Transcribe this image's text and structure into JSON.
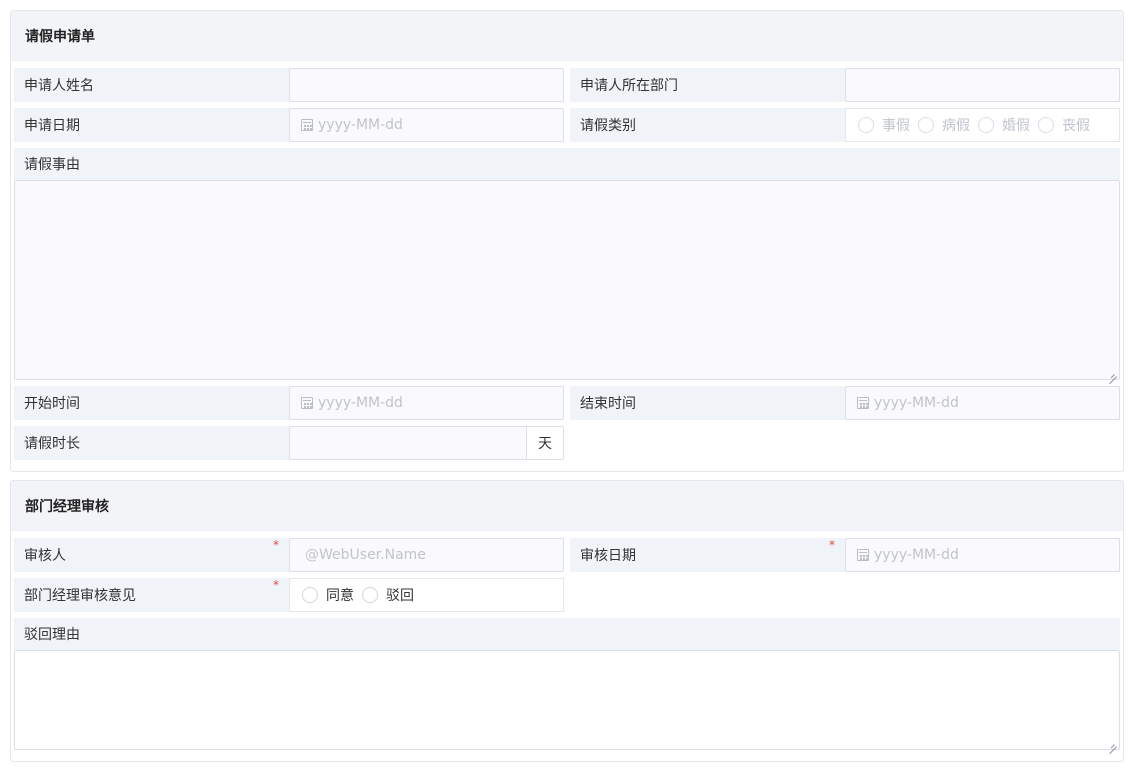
{
  "leave_form": {
    "title": "请假申请单",
    "applicant_name_label": "申请人姓名",
    "applicant_dept_label": "申请人所在部门",
    "apply_date_label": "申请日期",
    "apply_date_placeholder": "yyyy-MM-dd",
    "leave_type_label": "请假类别",
    "leave_type_options": [
      "事假",
      "病假",
      "婚假",
      "丧假"
    ],
    "reason_label": "请假事由",
    "start_time_label": "开始时间",
    "start_time_placeholder": "yyyy-MM-dd",
    "end_time_label": "结束时间",
    "end_time_placeholder": "yyyy-MM-dd",
    "duration_label": "请假时长",
    "duration_unit": "天"
  },
  "manager_review": {
    "title": "部门经理审核",
    "reviewer_label": "审核人",
    "reviewer_placeholder": "@WebUser.Name",
    "review_date_label": "审核日期",
    "review_date_placeholder": "yyyy-MM-dd",
    "opinion_label": "部门经理审核意见",
    "opinion_options": [
      "同意",
      "驳回"
    ],
    "reject_reason_label": "驳回理由"
  },
  "colors": {
    "label_bg": "#f0f3f7",
    "header_bg": "#f2f4f7",
    "required_mark": "#e24a4a",
    "placeholder": "#c0c4cc",
    "border": "#dcdfe6"
  },
  "icons": {
    "date": "calendar-icon",
    "radio": "radio-circle-icon"
  }
}
